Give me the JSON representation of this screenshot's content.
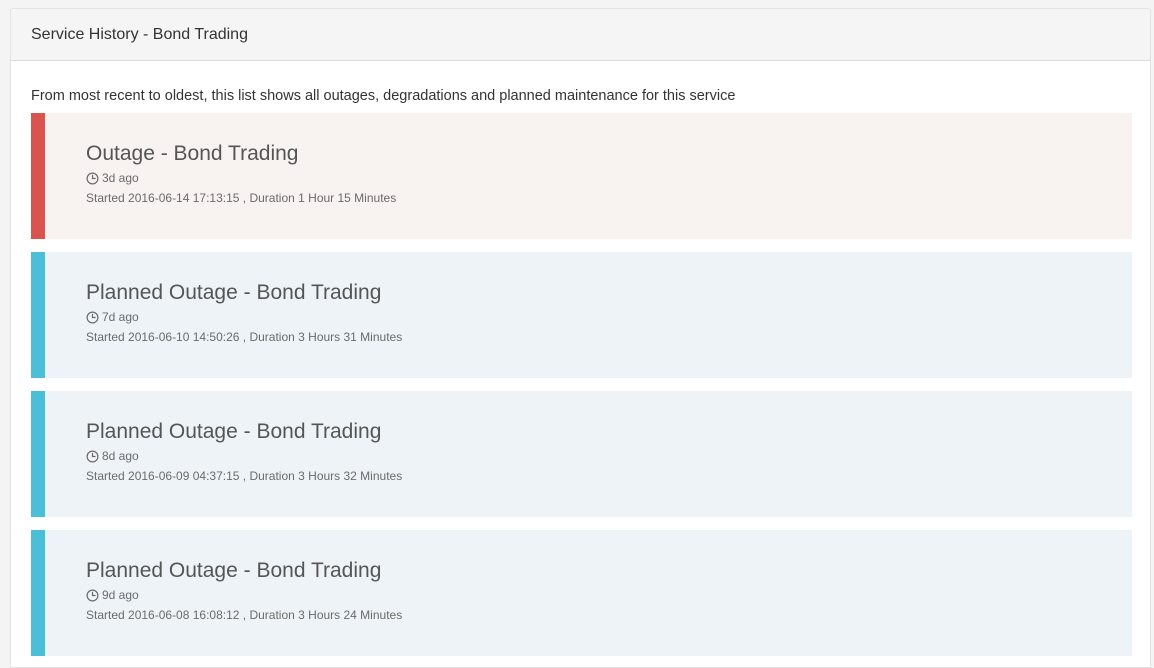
{
  "panel": {
    "title": "Service History - Bond Trading",
    "intro": "From most recent to oldest, this list shows all outages, degradations and planned maintenance for this service"
  },
  "incidents": [
    {
      "type": "outage",
      "title": "Outage - Bond Trading",
      "ago": "3d ago",
      "detail": "Started 2016-06-14 17:13:15 , Duration 1 Hour 15 Minutes",
      "accent": "#d9534f"
    },
    {
      "type": "planned",
      "title": "Planned Outage - Bond Trading",
      "ago": "7d ago",
      "detail": "Started 2016-06-10 14:50:26 , Duration 3 Hours 31 Minutes",
      "accent": "#4bbfd8"
    },
    {
      "type": "planned",
      "title": "Planned Outage - Bond Trading",
      "ago": "8d ago",
      "detail": "Started 2016-06-09 04:37:15 , Duration 3 Hours 32 Minutes",
      "accent": "#4bbfd8"
    },
    {
      "type": "planned",
      "title": "Planned Outage - Bond Trading",
      "ago": "9d ago",
      "detail": "Started 2016-06-08 16:08:12 , Duration 3 Hours 24 Minutes",
      "accent": "#4bbfd8"
    }
  ],
  "icons": {
    "time": "clock-icon"
  }
}
